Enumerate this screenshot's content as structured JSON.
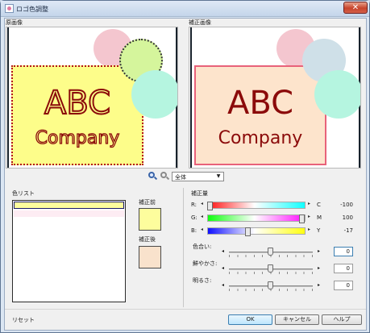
{
  "window": {
    "title": "ロゴ色調整",
    "close_label": "✕"
  },
  "preview": {
    "original_label": "原画像",
    "corrected_label": "補正画像",
    "logo_line1": "ABC",
    "logo_line2": "Company"
  },
  "zoom": {
    "zoom_in_icon": "zoom-in-icon",
    "zoom_out_icon": "zoom-out-icon",
    "selected": "全体"
  },
  "color_list": {
    "label": "色リスト"
  },
  "swatches": {
    "before_label": "補正前",
    "after_label": "補正後",
    "before_color": "#fdfd9d",
    "after_color": "#f9e2cc"
  },
  "correction": {
    "label": "補正量",
    "channels": [
      {
        "left": "R:",
        "right": "C",
        "value": "-100",
        "level": 0.0
      },
      {
        "left": "G:",
        "right": "M",
        "value": "100",
        "level": 1.0
      },
      {
        "left": "B:",
        "right": "Y",
        "value": "-17",
        "level": 0.41
      }
    ]
  },
  "adjustments": [
    {
      "label": "色合い:",
      "value": "0",
      "level": 0.5
    },
    {
      "label": "鮮やかさ:",
      "value": "0",
      "level": 0.5
    },
    {
      "label": "明るさ:",
      "value": "0",
      "level": 0.5
    }
  ],
  "buttons": {
    "reset": "リセット",
    "ok": "OK",
    "cancel": "キャンセル",
    "help": "ヘルプ"
  },
  "colors": {
    "accent": "#3c7fb1",
    "card_original": "#fdfd8a",
    "card_corrected": "#fde4cc",
    "text_logo": "#8b0a0a"
  }
}
